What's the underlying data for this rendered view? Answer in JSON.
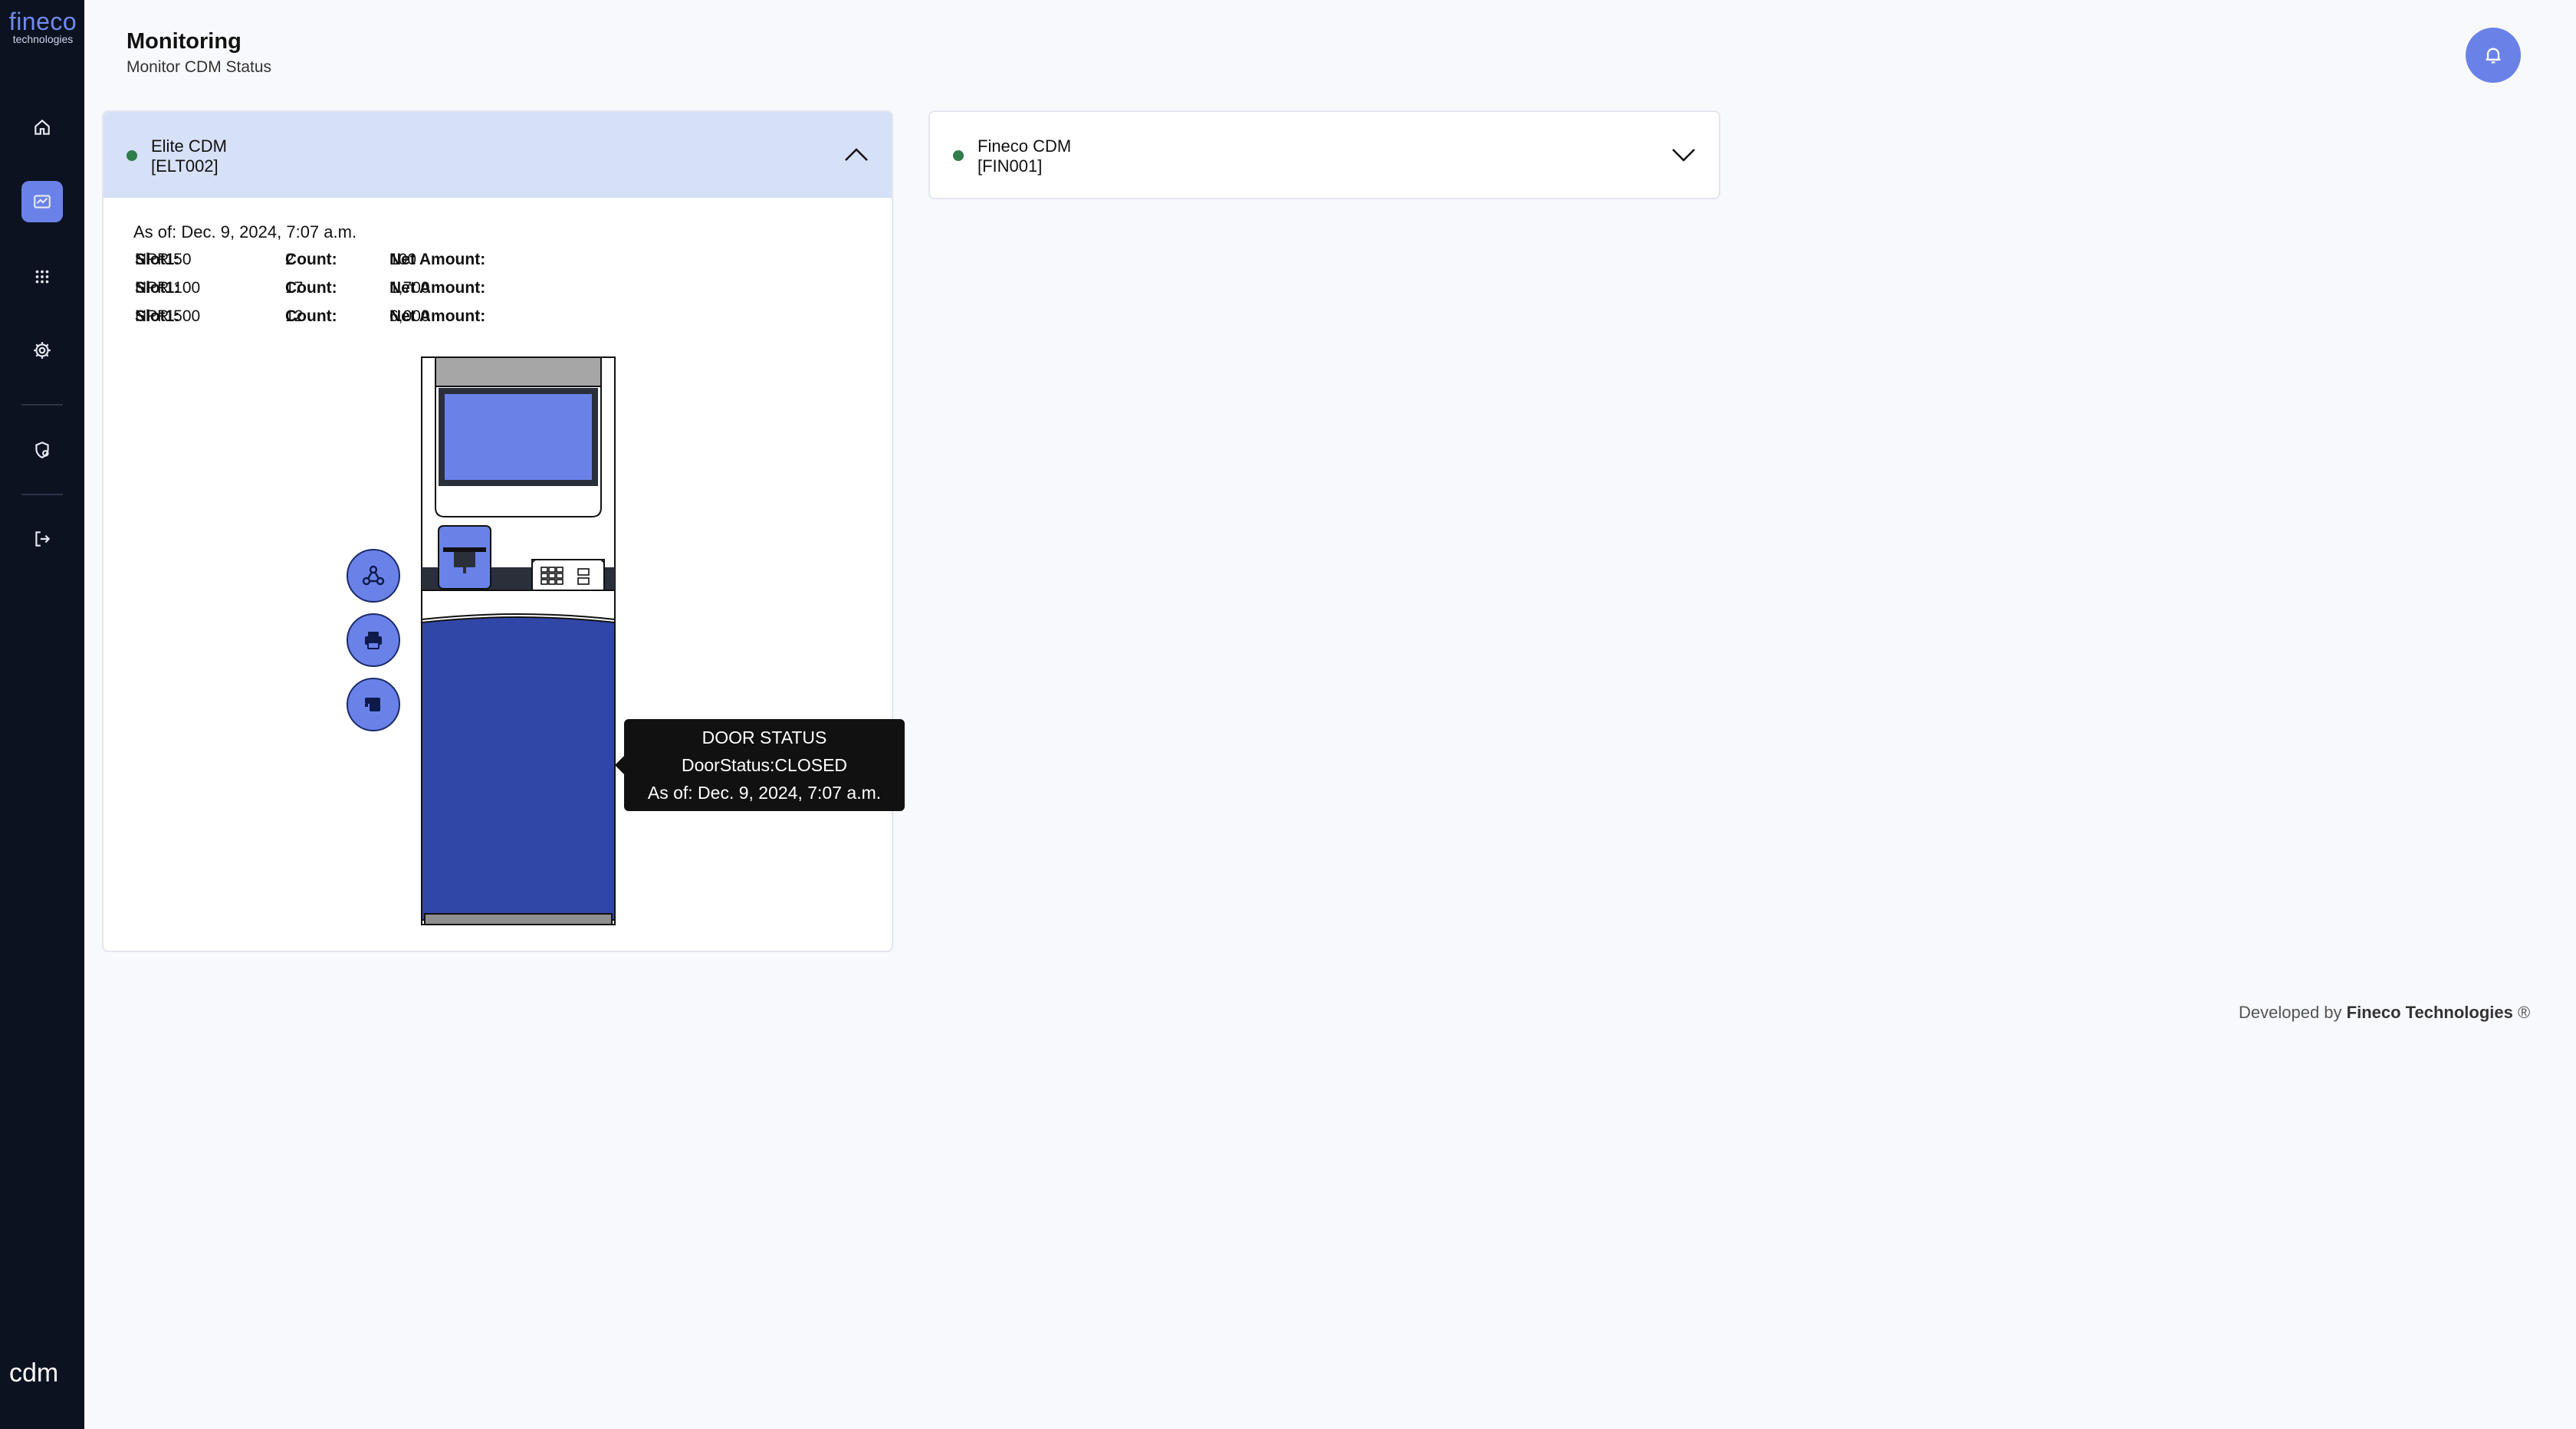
{
  "brand": {
    "logo_main": "fineco",
    "logo_sub": "technologies",
    "footer_logo": "cdm"
  },
  "sidebar": {
    "items": [
      {
        "icon": "home-icon"
      },
      {
        "icon": "monitoring-icon",
        "active": true
      },
      {
        "icon": "apps-grid-icon"
      },
      {
        "icon": "gear-icon"
      },
      {
        "icon": "shield-user-icon"
      },
      {
        "icon": "logout-icon"
      }
    ]
  },
  "header": {
    "title": "Monitoring",
    "subtitle": "Monitor CDM Status",
    "bell_icon": "bell-icon"
  },
  "cards": [
    {
      "name": "Elite CDM",
      "code": "[ELT002]",
      "status_color": "#2e7d4a",
      "expanded": true,
      "as_of_label": "As of:",
      "as_of_value": "Dec. 9, 2024, 7:07 a.m.",
      "slots": [
        {
          "slot_label": "Slot1:",
          "slot_value": "NPR 50",
          "count_label": "Count:",
          "count_value": "2",
          "net_label": "Net Amount:",
          "net_value": "100"
        },
        {
          "slot_label": "Slot1:",
          "slot_value": "NPR 100",
          "count_label": "Count:",
          "count_value": "17",
          "net_label": "Net Amount:",
          "net_value": "1,700"
        },
        {
          "slot_label": "Slot1:",
          "slot_value": "NPR 500",
          "count_label": "Count:",
          "count_value": "12",
          "net_label": "Net Amount:",
          "net_value": "6,000"
        }
      ],
      "side_buttons": [
        {
          "icon": "network-icon"
        },
        {
          "icon": "printer-icon"
        },
        {
          "icon": "cash-slot-icon"
        }
      ],
      "tooltip": {
        "title": "DOOR STATUS",
        "status": "DoorStatus:CLOSED",
        "as_of": "As of: Dec. 9, 2024, 7:07 a.m."
      }
    },
    {
      "name": "Fineco CDM",
      "code": "[FIN001]",
      "status_color": "#2e7d4a",
      "expanded": false
    }
  ],
  "footer": {
    "prefix": "Developed by",
    "company": "Fineco Technologies",
    "mark": "®"
  },
  "colors": {
    "accent": "#6a82e8",
    "sidebar_bg": "#0c1220",
    "card_head_active": "#d6e1f8",
    "machine_body": "#3147a8"
  }
}
